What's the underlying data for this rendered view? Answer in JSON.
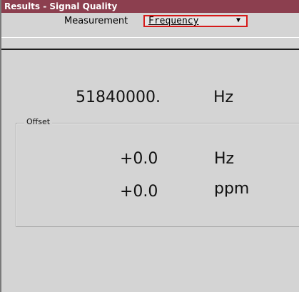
{
  "window": {
    "title": "Results - Signal Quality",
    "title_bar_color": "#8c3f4f"
  },
  "toolbar": {
    "measurement_label": "Measurement",
    "measurement_value": "Frequency",
    "dropdown_arrow": "▼"
  },
  "frequency": {
    "value": "51840000.",
    "unit": "Hz"
  },
  "offset": {
    "legend": "Offset",
    "rows": [
      {
        "value": "+0.0",
        "unit": "Hz"
      },
      {
        "value": "+0.0",
        "unit": "ppm"
      }
    ]
  },
  "colors": {
    "panel_background": "#d4d4d4",
    "dropdown_highlight": "#d61a1a"
  }
}
